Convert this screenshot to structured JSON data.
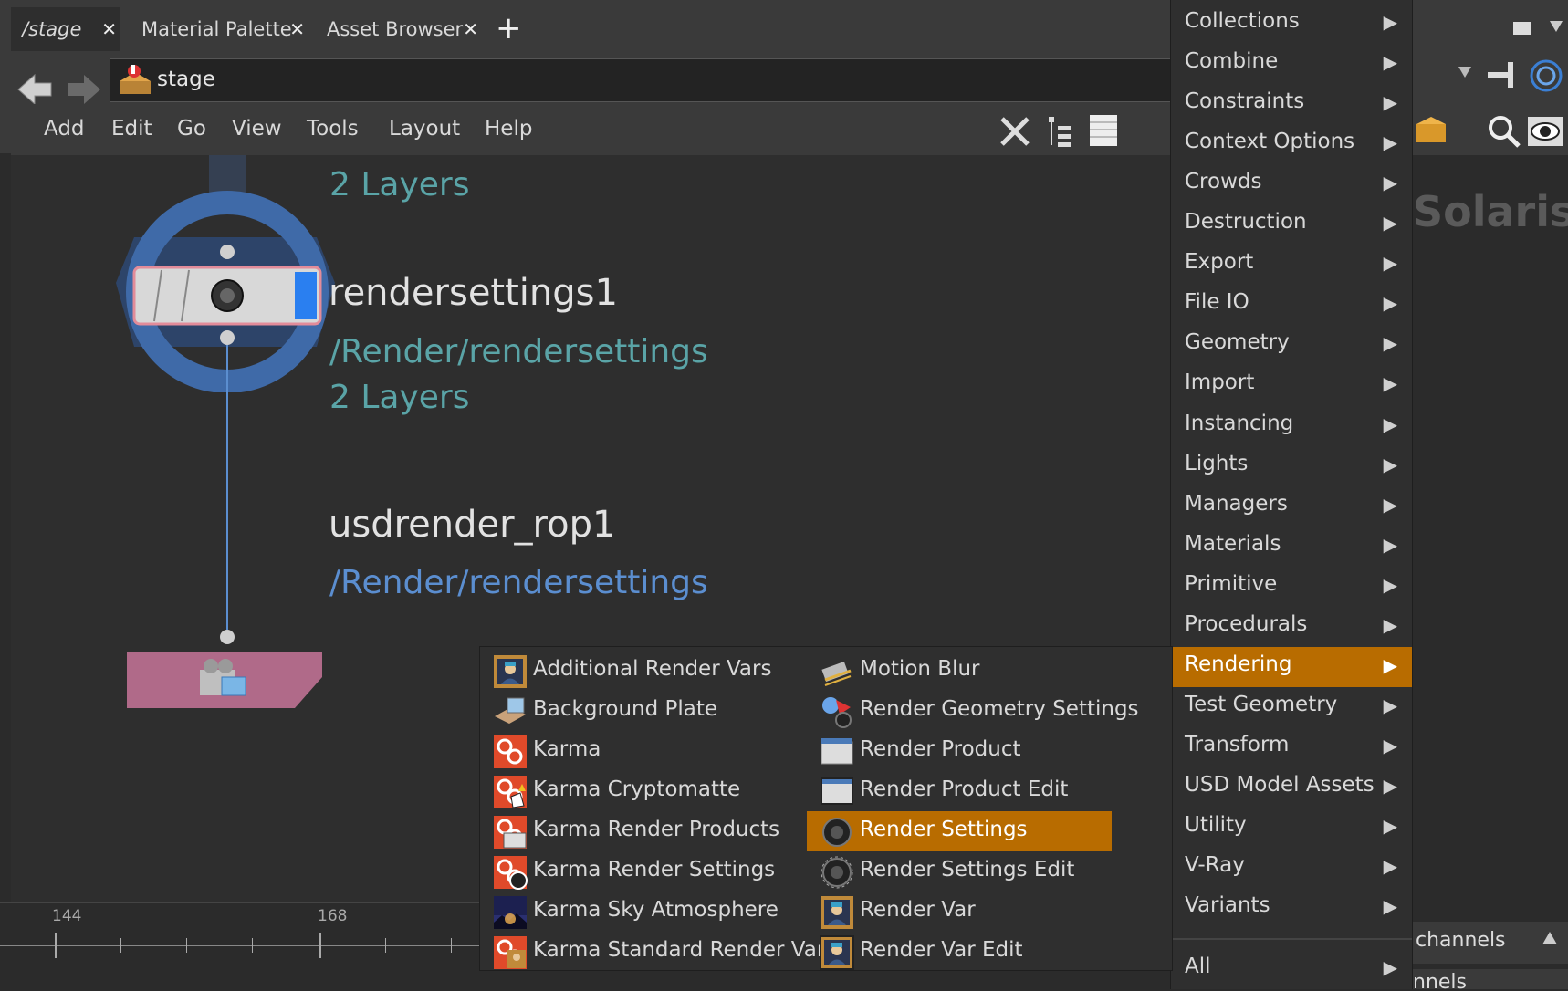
{
  "tabs": [
    {
      "label": "/stage",
      "active": true
    },
    {
      "label": "Material Palette",
      "active": false
    },
    {
      "label": "Asset Browser",
      "active": false
    }
  ],
  "tab_close_glyph": "✕",
  "tab_add_glyph": "+",
  "path": {
    "label": "stage"
  },
  "menubar": [
    "Add",
    "Edit",
    "Go",
    "View",
    "Tools",
    "Layout",
    "Help"
  ],
  "canvas": {
    "top_partial_layers": "2 Layers",
    "node1": {
      "name": "rendersettings1",
      "path": "/Render/rendersettings",
      "layers": "2 Layers"
    },
    "node2": {
      "name": "usdrender_rop1",
      "path": "/Render/rendersettings"
    }
  },
  "desktop_label": "Solaris",
  "timeline": {
    "ticks": [
      "144",
      "168"
    ]
  },
  "channels": {
    "label": "channels",
    "label2": "nnels"
  },
  "main_menu": {
    "items": [
      "Collections",
      "Combine",
      "Constraints",
      "Context Options",
      "Crowds",
      "Destruction",
      "Export",
      "File IO",
      "Geometry",
      "Import",
      "Instancing",
      "Lights",
      "Managers",
      "Materials",
      "Primitive",
      "Procedurals",
      "Rendering",
      "Test Geometry",
      "Transform",
      "USD Model Assets",
      "Utility",
      "V-Ray",
      "Variants"
    ],
    "highlighted": "Rendering",
    "all_label": "All",
    "arrow_glyph": "▶"
  },
  "submenu": {
    "left_column": [
      {
        "label": "Additional Render Vars",
        "icon": "portrait-icon"
      },
      {
        "label": "Background Plate",
        "icon": "plate-icon"
      },
      {
        "label": "Karma",
        "icon": "karma-icon"
      },
      {
        "label": "Karma Cryptomatte",
        "icon": "karma-cryptomatte-icon"
      },
      {
        "label": "Karma Render Products",
        "icon": "karma-products-icon"
      },
      {
        "label": "Karma Render Settings",
        "icon": "karma-settings-icon"
      },
      {
        "label": "Karma Sky Atmosphere",
        "icon": "sky-icon"
      },
      {
        "label": "Karma Standard Render Vars",
        "icon": "karma-vars-icon"
      }
    ],
    "right_column": [
      {
        "label": "Motion Blur",
        "icon": "motion-blur-icon"
      },
      {
        "label": "Render Geometry Settings",
        "icon": "geometry-settings-icon"
      },
      {
        "label": "Render Product",
        "icon": "film-icon"
      },
      {
        "label": "Render Product Edit",
        "icon": "film-edit-icon"
      },
      {
        "label": "Render Settings",
        "icon": "dial-icon"
      },
      {
        "label": "Render Settings Edit",
        "icon": "dial-edit-icon"
      },
      {
        "label": "Render Var",
        "icon": "portrait-icon"
      },
      {
        "label": "Render Var Edit",
        "icon": "portrait-edit-icon"
      }
    ],
    "highlighted": "Render Settings"
  },
  "colors": {
    "highlight": "#b86c00",
    "node_ring": "#3f6aa8",
    "node_sub_teal": "#5aa4a7",
    "node_sub_blue": "#5b8ed0",
    "rop_node": "#b06a89"
  }
}
